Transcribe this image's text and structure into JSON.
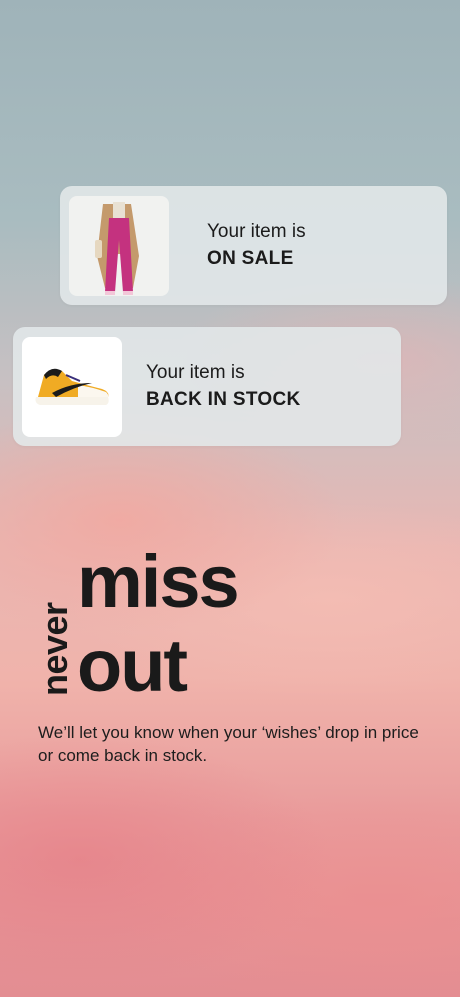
{
  "notifications": [
    {
      "line1": "Your item is",
      "line2": "ON SALE",
      "image": "model-pink-trousers-photo"
    },
    {
      "line1": "Your item is",
      "line2": "BACK IN STOCK",
      "image": "yellow-sneaker-photo"
    }
  ],
  "hero": {
    "word_vertical": "never",
    "word_line1": "miss",
    "word_line2": "out",
    "subtext": "We’ll let you know when your ‘wishes’ drop in price or come back in stock."
  },
  "colors": {
    "text": "#1a1a1a",
    "card_background": "#e2e8e9",
    "trousers_pink": "#c4327f",
    "sneaker_yellow": "#f0ab24"
  }
}
